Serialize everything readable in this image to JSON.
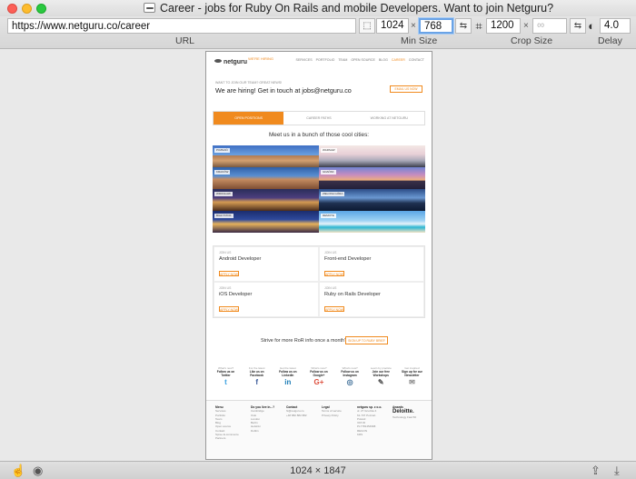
{
  "window": {
    "title": "Career - jobs for Ruby On Rails and mobile Developers. Want to join Netguru?"
  },
  "toolbar": {
    "url": "https://www.netguru.co/career",
    "url_label": "URL",
    "min_width": "1024",
    "min_height": "768",
    "min_size_label": "Min Size",
    "crop_width": "1200",
    "crop_height_placeholder": "∞",
    "crop_size_label": "Crop Size",
    "delay": "4.0",
    "delay_label": "Delay",
    "times": "×"
  },
  "page": {
    "logo": "netguru",
    "logo_tag": "WE'RE HIRING",
    "nav": [
      "SERVICES",
      "PORTFOLIO",
      "TEAM",
      "OPEN SOURCE",
      "BLOG",
      "CAREER",
      "CONTACT"
    ],
    "nav_active": "CAREER",
    "hire_small": "WANT TO JOIN OUR TEAM? GREAT NEWS!",
    "hire_text": "We are hiring! Get in touch at ",
    "hire_email": "jobs@netguru.co",
    "email_button": "EMAIL US NOW",
    "tabs": [
      "OPEN POSITIONS",
      "CAREER PATHS",
      "WORKING AT NETGURU"
    ],
    "cities_heading": "Meet us in a bunch of those cool cities:",
    "cities": [
      "POZNAŃ",
      "WARSAW",
      "KRAKÓW",
      "GDAŃSK",
      "WROCŁAW",
      "ZIELONA GÓRA",
      "BIAŁYSTOK",
      "REMOTE"
    ],
    "jobs": [
      {
        "label": "JOIN US",
        "title": "Android Developer",
        "button": "APPLY NOW"
      },
      {
        "label": "JOIN US",
        "title": "Front-end Developer",
        "button": "APPLY NOW"
      },
      {
        "label": "JOIN US",
        "title": "iOS Developer",
        "button": "APPLY NOW"
      },
      {
        "label": "JOIN US",
        "title": "Ruby on Rails Developer",
        "button": "APPLY NOW"
      }
    ],
    "strive_text": "Strive for more RoR info once a month?",
    "strive_button": "SIGN UP TO RUBY BRIEF",
    "follow": [
      {
        "a": "What's new?",
        "b": "Follow us on Twitter",
        "icon": "t"
      },
      {
        "a": "For the latest",
        "b": "Like us on Facebook",
        "icon": "f"
      },
      {
        "a": "Get the latest",
        "b": "Follow us on LinkedIn",
        "icon": "in"
      },
      {
        "a": "What's new?",
        "b": "Follow us on Google+",
        "icon": "G+"
      },
      {
        "a": "What's new?",
        "b": "Follow us on Instagram",
        "icon": "◎"
      },
      {
        "a": "Learn by practice",
        "b": "Join our free Workshops",
        "icon": "✎"
      },
      {
        "a": "Get inspired",
        "b": "Sign up for our Newsletter",
        "icon": "✉"
      }
    ],
    "footer": {
      "menu_title": "Menu",
      "menu": [
        "Services",
        "Portfolio",
        "Team",
        "Blog",
        "Open source",
        "Contact",
        "Spree E-commerce",
        "Partners"
      ],
      "local_title": "Do you live in...?",
      "local": [
        "Cambridge",
        "Oslo",
        "London",
        "Berlin",
        "Helsinki",
        "Dublin"
      ],
      "contact_title": "Contact",
      "contact": [
        "hi@netguru.co",
        "+48 882 882 882"
      ],
      "legal_title": "Legal",
      "legal": [
        "Terms of service",
        "Privacy Policy"
      ],
      "company_title": "netguru sp. z o.o.",
      "company": [
        "ul. 27 Grudnia 4",
        "61-737 Poznań",
        "Poland",
        "VAT-ID",
        "PL7781454968",
        "REGON",
        "KRS"
      ],
      "awards_title": "Awards",
      "deloitte": "Deloitte.",
      "deloitte_sub": "Technology Fast 50"
    }
  },
  "status": {
    "dimensions": "1024 × 1847"
  }
}
